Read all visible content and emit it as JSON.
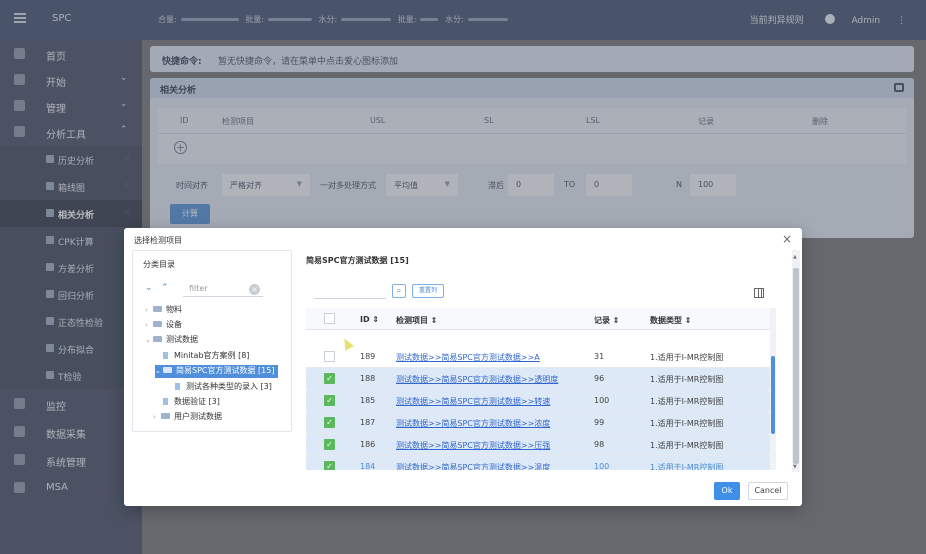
{
  "topbar": {
    "app_title": "SPC",
    "stat1": "合量:",
    "stat2": "批量:",
    "stat3": "水分:",
    "stat4": "批量:",
    "stat5": "水分:",
    "rule_link": "当前判异规则",
    "user": "Admin"
  },
  "sidebar": {
    "items": [
      {
        "label": "首页"
      },
      {
        "label": "开始"
      },
      {
        "label": "管理"
      },
      {
        "label": "分析工具"
      }
    ],
    "subitems": [
      {
        "label": "历史分析"
      },
      {
        "label": "箱线图"
      },
      {
        "label": "相关分析"
      },
      {
        "label": "CPK计算"
      },
      {
        "label": "方差分析"
      },
      {
        "label": "回归分析"
      },
      {
        "label": "正态性检验"
      },
      {
        "label": "分布拟合"
      },
      {
        "label": "T检验"
      }
    ],
    "bottom_items": [
      {
        "label": "监控"
      },
      {
        "label": "数据采集"
      },
      {
        "label": "系统管理"
      },
      {
        "label": "MSA"
      }
    ]
  },
  "quick": {
    "label": "快捷命令:",
    "text": "暂无快捷命令，请在菜单中点击爱心图标添加"
  },
  "analysis": {
    "title": "相关分析",
    "columns": [
      "ID",
      "检测项目",
      "USL",
      "SL",
      "LSL",
      "记录",
      "删除"
    ],
    "time_align_label": "时间对齐",
    "time_align_value": "严格对齐",
    "multi_label": "一对多处理方式",
    "multi_value": "平均值",
    "lag_label": "滞后",
    "lag_value": "0",
    "to_label": "TO",
    "to_value": "0",
    "n_label": "N",
    "n_value": "100",
    "calc_button": "计算"
  },
  "modal": {
    "title": "选择检测项目",
    "category_title": "分类目录",
    "filter_placeholder": "filter",
    "tree": [
      {
        "label": "物料"
      },
      {
        "label": "设备"
      },
      {
        "label": "测试数据"
      },
      {
        "label": "Minitab官方案例 [8]"
      },
      {
        "label": "简易SPC官方测试数据 [15]"
      },
      {
        "label": "测试各种类型的录入 [3]"
      },
      {
        "label": "数据验证 [3]"
      },
      {
        "label": "用户测试数据"
      }
    ],
    "right_title": "简易SPC官方测试数据 [15]",
    "reset_label": "重置列",
    "headers": {
      "id": "ID",
      "item": "检测项目",
      "records": "记录",
      "type": "数据类型"
    },
    "rows": [
      {
        "id": "189",
        "item": "测试数据>>简易SPC官方测试数据>>A",
        "records": "31",
        "type": "1.适用于I-MR控制图"
      },
      {
        "id": "188",
        "item": "测试数据>>简易SPC官方测试数据>>透明度",
        "records": "96",
        "type": "1.适用于I-MR控制图"
      },
      {
        "id": "185",
        "item": "测试数据>>简易SPC官方测试数据>>转速",
        "records": "100",
        "type": "1.适用于I-MR控制图"
      },
      {
        "id": "187",
        "item": "测试数据>>简易SPC官方测试数据>>浓度",
        "records": "99",
        "type": "1.适用于I-MR控制图"
      },
      {
        "id": "186",
        "item": "测试数据>>简易SPC官方测试数据>>压强",
        "records": "98",
        "type": "1.适用于I-MR控制图"
      },
      {
        "id": "184",
        "item": "测试数据>>简易SPC官方测试数据>>温度",
        "records": "100",
        "type": "1.适用于I-MR控制图"
      }
    ],
    "ok_label": "Ok",
    "cancel_label": "Cancel"
  }
}
